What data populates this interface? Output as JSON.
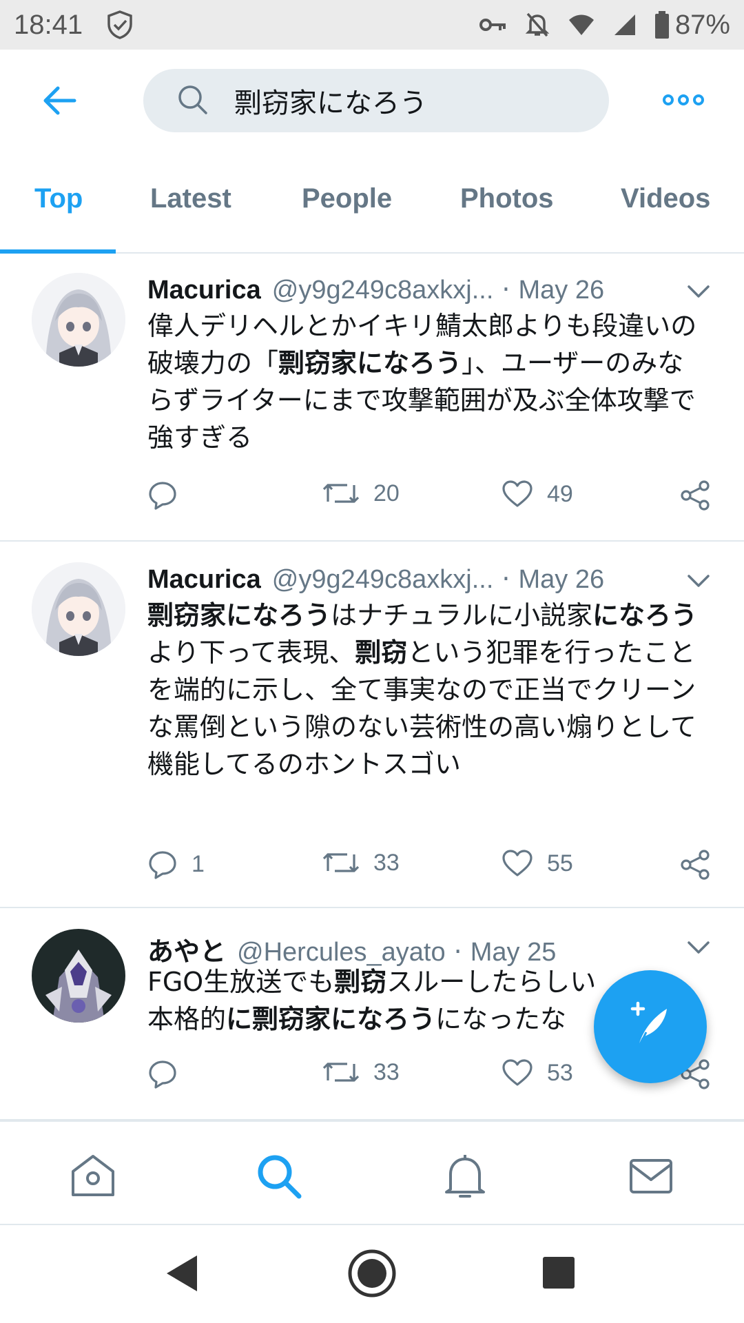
{
  "status_bar": {
    "time": "18:41",
    "battery": "87%",
    "icons": [
      "shield-check-icon",
      "vpn-key-icon",
      "notifications-off-icon",
      "wifi-icon",
      "signal-icon",
      "battery-icon"
    ]
  },
  "search": {
    "query": "剽窃家になろう",
    "icons": [
      "back-arrow-icon",
      "search-icon",
      "more-options-icon"
    ]
  },
  "tabs": [
    {
      "label": "Top",
      "active": true
    },
    {
      "label": "Latest",
      "active": false
    },
    {
      "label": "People",
      "active": false
    },
    {
      "label": "Photos",
      "active": false
    },
    {
      "label": "Videos",
      "active": false
    }
  ],
  "tweets": [
    {
      "name": "Macurica",
      "handle": "@y9g249c8axkxj...",
      "date": "May 26",
      "text_parts": [
        "偉人デリヘルとかイキリ鯖太郎よりも段違いの破壊力の「",
        "剽窃家になろう",
        "」、ユーザーのみならずライターにまで攻撃範囲が及ぶ全体攻撃で強すぎる"
      ],
      "replies": "",
      "retweets": "20",
      "likes": "49"
    },
    {
      "name": "Macurica",
      "handle": "@y9g249c8axkxj...",
      "date": "May 26",
      "text_parts": [
        "剽窃家になろう",
        "はナチュラルに小説家",
        "になろう",
        "より下って表現、",
        "剽窃",
        "という犯罪を行ったことを端的に示し、全て事実なので正当でクリーンな罵倒という隙のない芸術性の高い煽りとして機能してるのホントスゴい"
      ],
      "replies": "1",
      "retweets": "33",
      "likes": "55"
    },
    {
      "name": "あやと",
      "handle": "@Hercules_ayato",
      "date": "May 25",
      "text_parts": [
        "FGO生放送でも",
        "剽窃",
        "スルーしたらしい",
        "本格的",
        "に",
        "剽窃家になろう",
        "になったな"
      ],
      "replies": "",
      "retweets": "33",
      "likes": "53"
    }
  ],
  "bottom_nav": [
    "home-icon",
    "search-icon",
    "notifications-icon",
    "messages-icon"
  ],
  "colors": {
    "accent": "#1da1f2",
    "muted": "#657786",
    "text": "#14171a",
    "divider": "#e1e8ed"
  }
}
